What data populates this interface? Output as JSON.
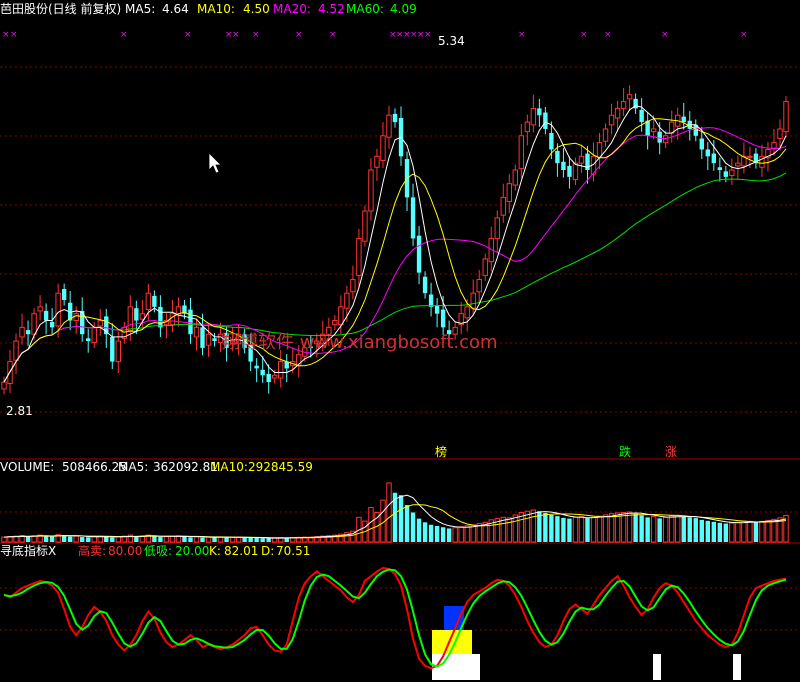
{
  "title_bar": {
    "name": "芭田股份(日线 前复权)",
    "ma5_label": "MA5:",
    "ma5_value": "4.64",
    "ma10_label": "MA10:",
    "ma10_value": "4.50",
    "ma20_label": "MA20:",
    "ma20_value": "4.52",
    "ma60_label": "MA60:",
    "ma60_value": "4.09"
  },
  "watermark": "翔博软件 www.xiangbosoft.com",
  "markers": {
    "bang": "榜",
    "die": "跌",
    "zhang": "涨"
  },
  "volume_header": {
    "label": "VOLUME:",
    "value": "508466.25",
    "ma5_label": "MA5:",
    "ma5_value": "362092.81",
    "ma10_label": "MA10:",
    "ma10_value": "292845.59"
  },
  "indicator_header": {
    "name": "寻底指标X",
    "gaomai_label": "高卖:",
    "gaomai_value": "80.00",
    "dixi_label": "低吸:",
    "dixi_value": "20.00",
    "k_label": "K:",
    "k_value": "82.01",
    "d_label": "D:",
    "d_value": "70.51"
  },
  "colors": {
    "up": "#ff3232",
    "down": "#54ffff",
    "ma5": "#ffffff",
    "ma10": "#ffff00",
    "ma20": "#ff00ff",
    "ma60": "#00e000",
    "grid": "#8b0000",
    "k_line": "#ff0000",
    "d_line": "#00ff00"
  },
  "chart_data": [
    {
      "type": "candlestick",
      "price_labels": {
        "high": "5.34",
        "low": "2.81"
      },
      "ylim": [
        2.6,
        5.45
      ],
      "points": 131,
      "close": [
        2.95,
        3.1,
        3.25,
        3.35,
        3.3,
        3.45,
        3.5,
        3.4,
        3.35,
        3.6,
        3.55,
        3.4,
        3.45,
        3.3,
        3.25,
        3.35,
        3.4,
        3.3,
        3.1,
        3.25,
        3.35,
        3.5,
        3.4,
        3.45,
        3.6,
        3.5,
        3.35,
        3.4,
        3.45,
        3.5,
        3.45,
        3.3,
        3.35,
        3.2,
        3.3,
        3.25,
        3.3,
        3.2,
        3.25,
        3.3,
        3.2,
        3.1,
        3.05,
        3.0,
        2.95,
        3.0,
        3.1,
        3.05,
        3.1,
        3.15,
        3.2,
        3.2,
        3.25,
        3.3,
        3.35,
        3.4,
        3.5,
        3.6,
        3.7,
        4.0,
        4.2,
        4.5,
        4.6,
        4.75,
        4.9,
        4.85,
        4.6,
        4.3,
        4.0,
        3.75,
        3.6,
        3.5,
        3.45,
        3.35,
        3.3,
        3.35,
        3.45,
        3.5,
        3.6,
        3.7,
        3.85,
        4.0,
        4.15,
        4.3,
        4.4,
        4.5,
        4.75,
        4.85,
        4.95,
        4.9,
        4.8,
        4.65,
        4.55,
        4.5,
        4.45,
        4.55,
        4.6,
        4.5,
        4.6,
        4.7,
        4.8,
        4.9,
        4.95,
        5.0,
        5.05,
        4.95,
        4.85,
        4.75,
        4.8,
        4.7,
        4.75,
        4.85,
        4.9,
        4.85,
        4.8,
        4.75,
        4.65,
        4.6,
        4.55,
        4.5,
        4.45,
        4.5,
        4.55,
        4.6,
        4.6,
        4.55,
        4.6,
        4.65,
        4.7,
        4.8,
        5.0
      ],
      "ma_periods": [
        5,
        10,
        20,
        60
      ]
    },
    {
      "type": "bar",
      "series": "volume",
      "values": [
        20,
        22,
        24,
        26,
        22,
        25,
        28,
        24,
        22,
        30,
        27,
        22,
        24,
        20,
        19,
        22,
        24,
        21,
        18,
        22,
        24,
        28,
        22,
        24,
        28,
        24,
        20,
        22,
        23,
        25,
        22,
        19,
        21,
        18,
        20,
        19,
        20,
        18,
        19,
        20,
        18,
        17,
        16,
        15,
        15,
        16,
        18,
        17,
        18,
        19,
        20,
        20,
        22,
        24,
        26,
        28,
        32,
        38,
        44,
        100,
        85,
        140,
        120,
        170,
        240,
        200,
        190,
        150,
        120,
        95,
        80,
        70,
        65,
        60,
        55,
        58,
        62,
        66,
        70,
        75,
        80,
        90,
        95,
        100,
        98,
        110,
        120,
        125,
        130,
        125,
        118,
        110,
        105,
        98,
        95,
        100,
        103,
        97,
        100,
        105,
        110,
        115,
        118,
        120,
        122,
        115,
        108,
        100,
        104,
        96,
        100,
        106,
        108,
        104,
        100,
        97,
        90,
        86,
        82,
        78,
        75,
        77,
        80,
        84,
        84,
        80,
        84,
        88,
        92,
        98,
        108
      ],
      "ylim": [
        0,
        260
      ]
    },
    {
      "type": "line",
      "series_k": [
        72,
        70,
        74,
        78,
        80,
        82,
        84,
        83,
        80,
        74,
        60,
        45,
        38,
        45,
        55,
        62,
        58,
        50,
        38,
        30,
        25,
        30,
        38,
        50,
        58,
        52,
        40,
        32,
        28,
        30,
        34,
        38,
        34,
        28,
        30,
        28,
        26,
        28,
        30,
        34,
        38,
        44,
        45,
        38,
        30,
        25,
        24,
        30,
        50,
        70,
        82,
        88,
        92,
        88,
        84,
        80,
        76,
        70,
        66,
        72,
        84,
        88,
        92,
        95,
        94,
        90,
        80,
        60,
        35,
        18,
        12,
        10,
        12,
        20,
        32,
        44,
        56,
        66,
        72,
        75,
        78,
        82,
        85,
        84,
        80,
        72,
        62,
        50,
        40,
        32,
        28,
        30,
        38,
        50,
        60,
        64,
        60,
        56,
        64,
        72,
        78,
        84,
        88,
        80,
        70,
        62,
        55,
        60,
        70,
        78,
        82,
        80,
        74,
        66,
        58,
        50,
        44,
        38,
        34,
        30,
        28,
        30,
        40,
        55,
        70,
        78,
        80,
        82,
        84,
        85,
        86
      ],
      "ylim": [
        0,
        100
      ],
      "levels": {
        "high_sell": 80,
        "low_buy": 20
      }
    }
  ]
}
